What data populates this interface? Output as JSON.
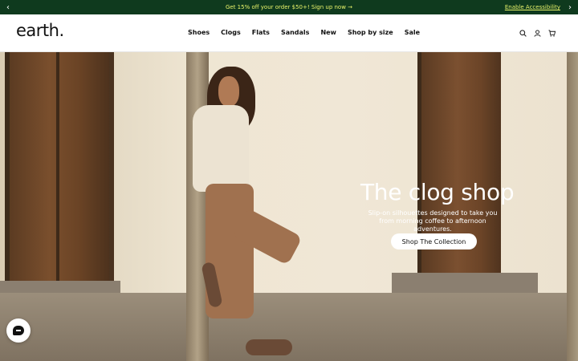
{
  "announcement": {
    "message": "Get 15% off your order $50+! Sign up now →",
    "accessibility_link": "Enable Accessibility",
    "prev_arrow": "‹",
    "next_arrow": "›",
    "bg_color": "#0f3a1e",
    "text_color": "#e9f46a"
  },
  "header": {
    "logo": "earth.",
    "nav": [
      "Shoes",
      "Clogs",
      "Flats",
      "Sandals",
      "New",
      "Shop by size",
      "Sale"
    ],
    "icons": [
      "search-icon",
      "account-icon",
      "cart-icon"
    ]
  },
  "hero": {
    "title": "The clog shop",
    "subtitle": "Slip-on silhouettes designed to take you from morning coffee to afternoon adventures.",
    "cta_label": "Shop The Collection"
  },
  "chat": {
    "icon": "chat-icon"
  }
}
